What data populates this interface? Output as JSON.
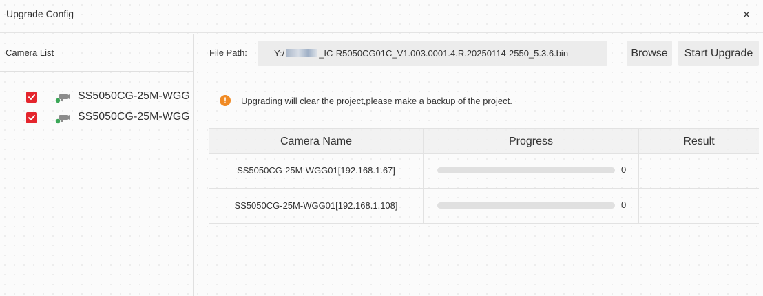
{
  "window": {
    "title": "Upgrade Config",
    "close_glyph": "×"
  },
  "left_panel": {
    "header": "Camera List",
    "cameras": [
      {
        "label": "SS5050CG-25M-WGG",
        "checked": true,
        "icon": "camera-icon"
      },
      {
        "label": "SS5050CG-25M-WGG",
        "checked": true,
        "icon": "camera-icon"
      }
    ]
  },
  "file_path": {
    "label": "File Path:",
    "prefix": "Y:/",
    "suffix": "_IC-R5050CG01C_V1.003.0001.4.R.20250114-2550_5.3.6.bin"
  },
  "buttons": {
    "browse": "Browse",
    "start_upgrade": "Start Upgrade"
  },
  "warning": {
    "icon": "!",
    "text": "Upgrading will clear the project,please make a backup of the project."
  },
  "table": {
    "headers": [
      "Camera Name",
      "Progress",
      "Result"
    ],
    "rows": [
      {
        "name": "SS5050CG-25M-WGG01[192.168.1.67]",
        "progress": 0,
        "progress_label": "0",
        "result": ""
      },
      {
        "name": "SS5050CG-25M-WGG01[192.168.1.108]",
        "progress": 0,
        "progress_label": "0",
        "result": ""
      }
    ]
  },
  "colors": {
    "checkbox": "#e4252d",
    "warning": "#f08a24",
    "camera_icon_body": "#8c8c8c",
    "camera_icon_status": "#3aa757"
  }
}
